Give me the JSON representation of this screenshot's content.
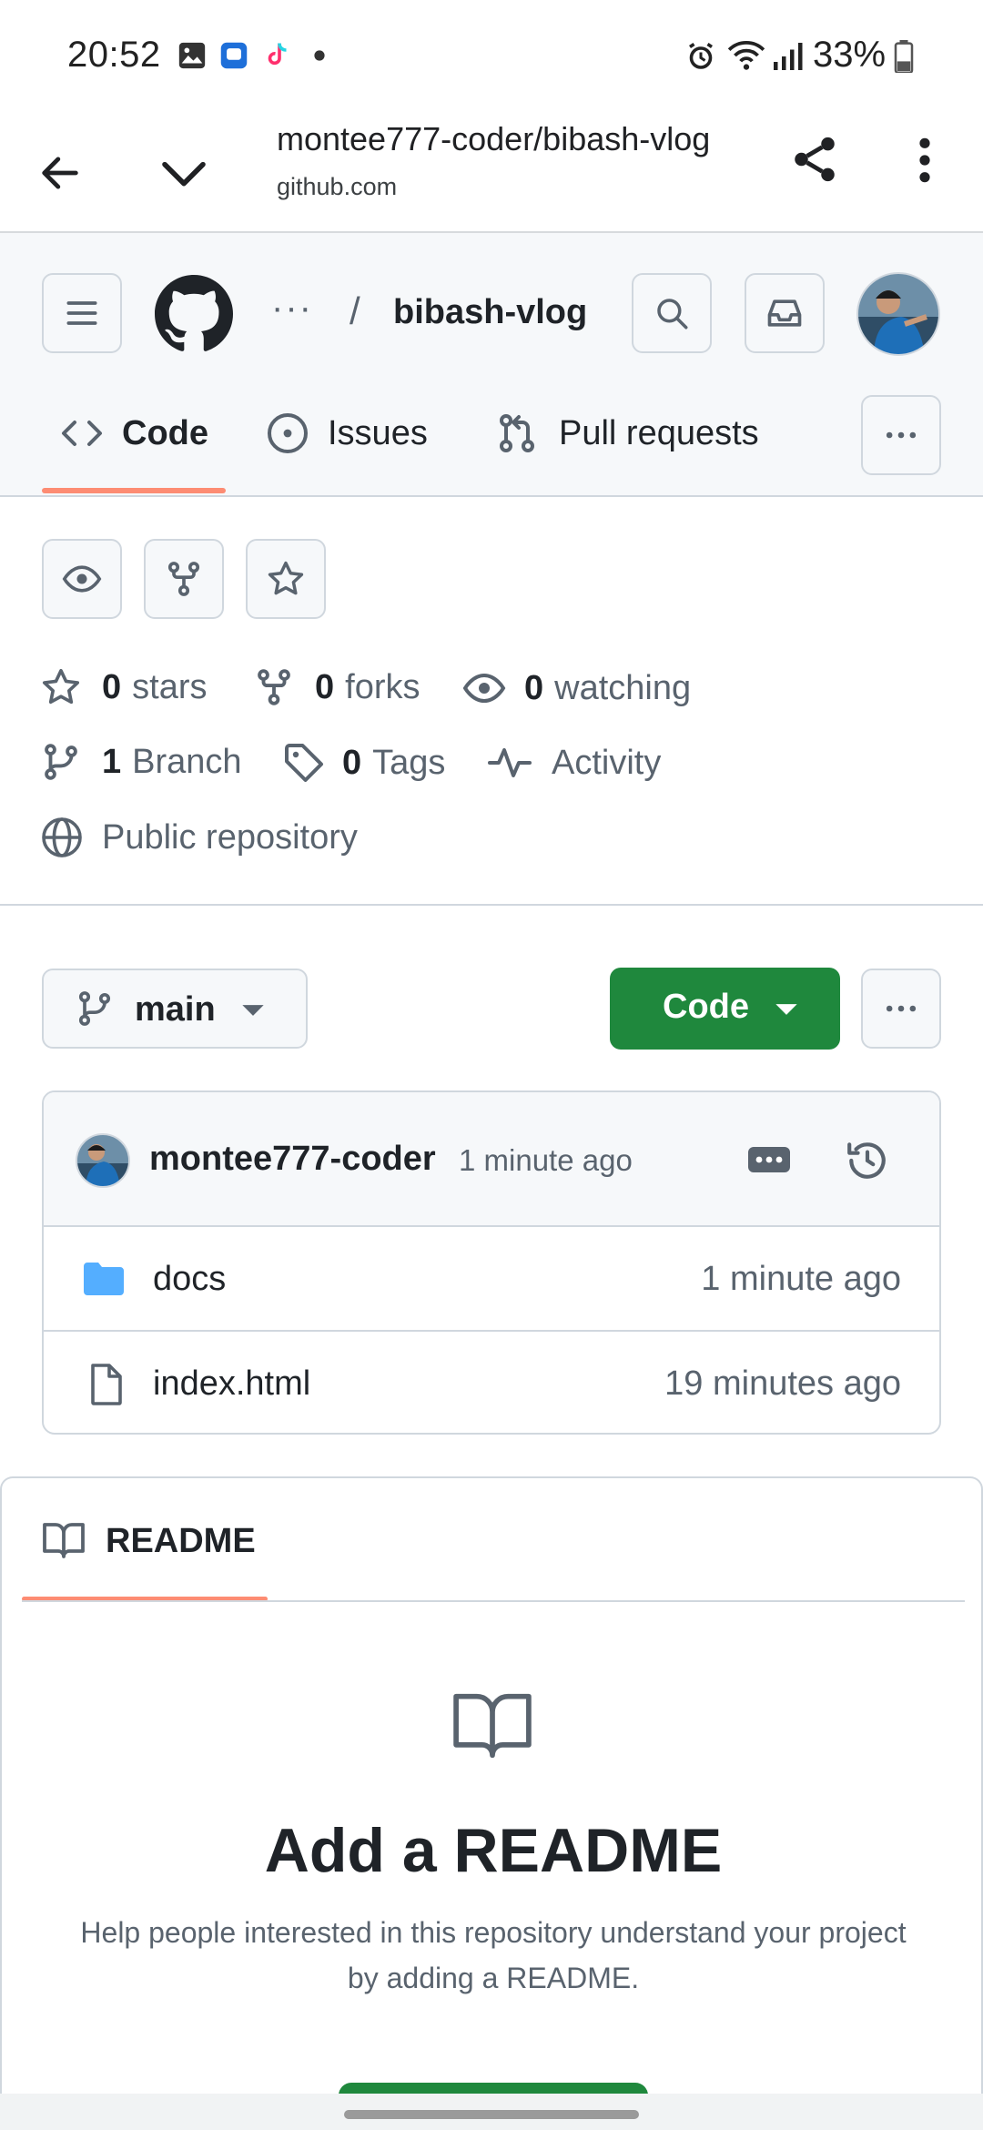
{
  "status": {
    "time": "20:52",
    "battery": "33%"
  },
  "browser": {
    "title": "montee777-coder/bibash-vlog",
    "domain": "github.com"
  },
  "header": {
    "repo_name": "bibash-vlog",
    "ellipsis": "···",
    "slash": "/",
    "tabs": [
      {
        "label": "Code",
        "icon": "code-icon",
        "selected": true
      },
      {
        "label": "Issues",
        "icon": "issue-opened-icon",
        "selected": false
      },
      {
        "label": "Pull requests",
        "icon": "git-pull-request-icon",
        "selected": false
      }
    ]
  },
  "stats": {
    "stars_count": "0",
    "stars_label": "stars",
    "forks_count": "0",
    "forks_label": "forks",
    "watching_count": "0",
    "watching_label": "watching",
    "branch_count": "1",
    "branch_label": "Branch",
    "tags_count": "0",
    "tags_label": "Tags",
    "activity_label": "Activity",
    "visibility": "Public repository"
  },
  "branch": {
    "name": "main",
    "code_button": "Code"
  },
  "commit": {
    "author": "montee777-coder",
    "time": "1 minute ago"
  },
  "files": [
    {
      "name": "docs",
      "type": "folder",
      "time": "1 minute ago"
    },
    {
      "name": "index.html",
      "type": "file",
      "time": "19 minutes ago"
    }
  ],
  "readme": {
    "tab_label": "README",
    "title": "Add a README",
    "desc_line1": "Help people interested in this repository understand your project",
    "desc_line2": "by adding a README."
  },
  "colors": {
    "accent": "#fd8c73",
    "primary_button": "#1f883d",
    "folder": "#54aeff"
  }
}
